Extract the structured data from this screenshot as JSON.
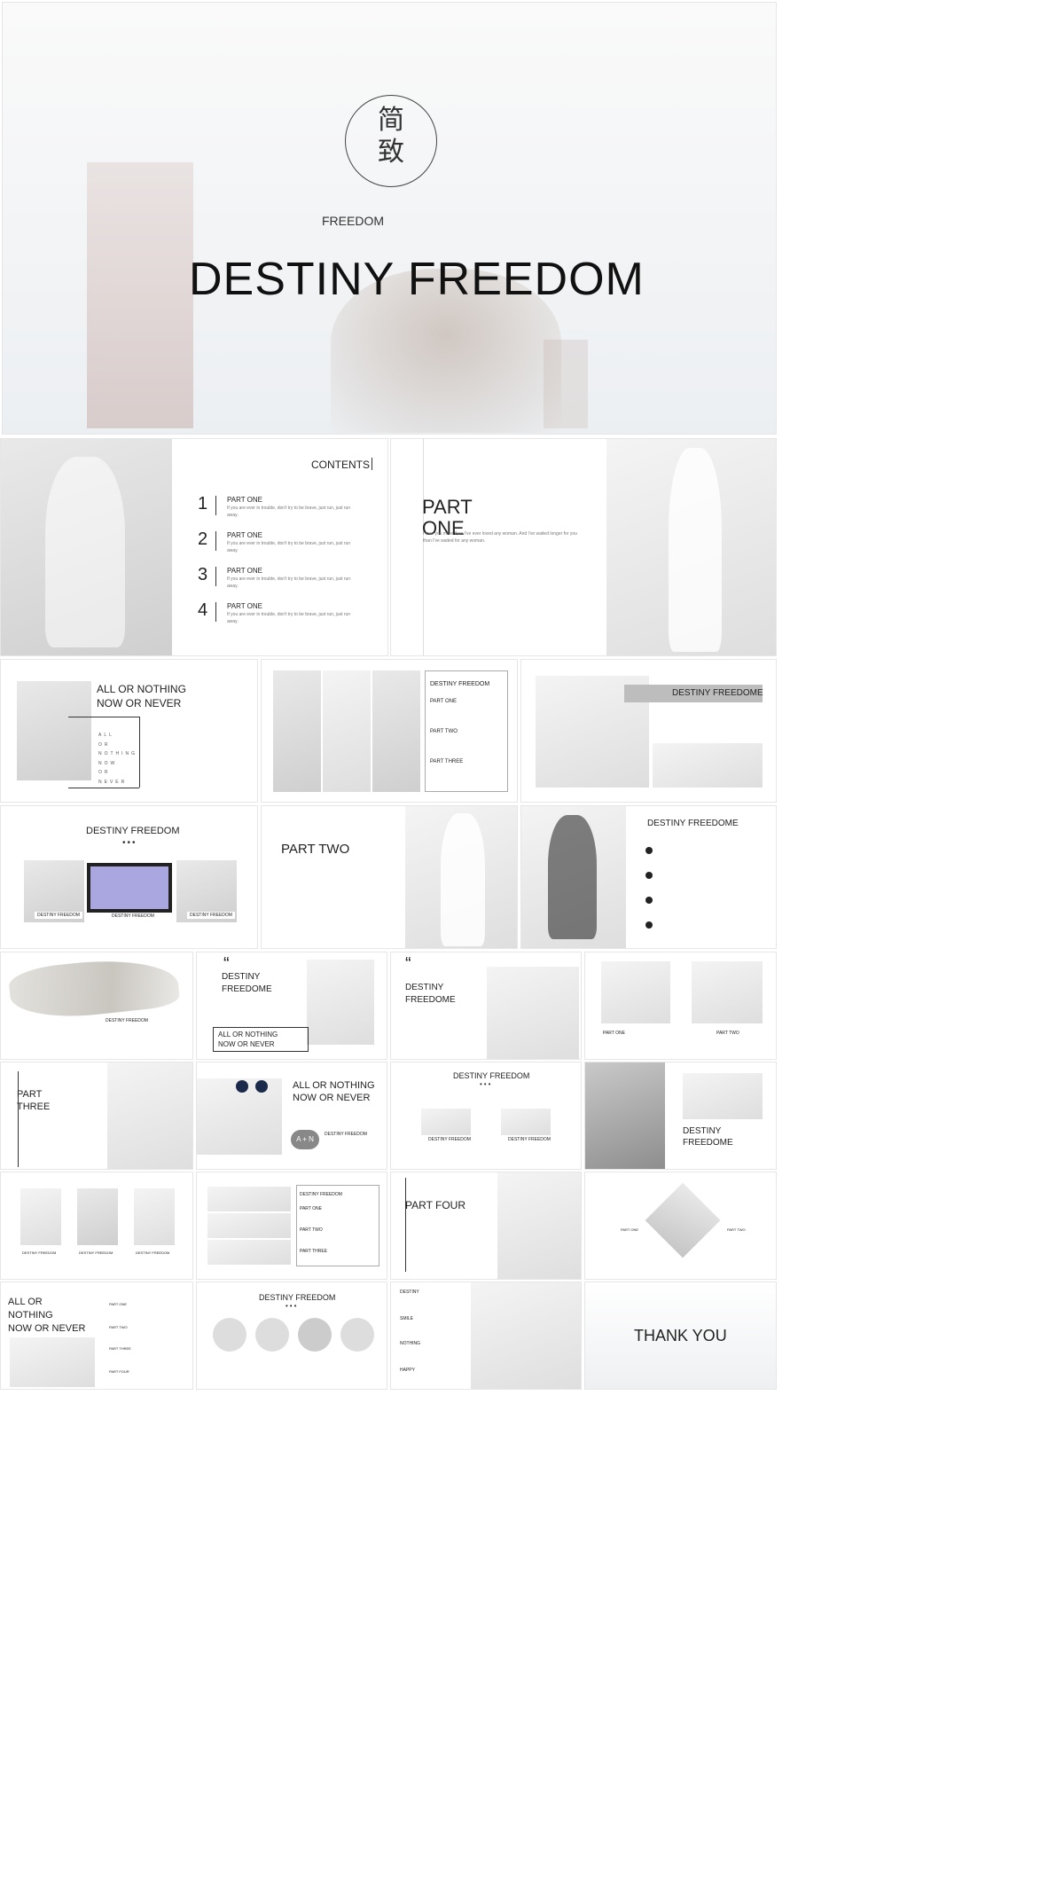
{
  "cover": {
    "emblem_line1": "简",
    "emblem_line2": "致",
    "kicker": "FREEDOM",
    "title": "DESTINY FREEDOM"
  },
  "contents": {
    "heading": "CONTENTS",
    "items": [
      {
        "num": "1",
        "label": "PART ONE",
        "desc": "If you are ever in trouble, don't try to be brave, just run, just run away."
      },
      {
        "num": "2",
        "label": "PART ONE",
        "desc": "If you are ever in trouble, don't try to be brave, just run, just run away."
      },
      {
        "num": "3",
        "label": "PART ONE",
        "desc": "If you are ever in trouble, don't try to be brave, just run, just run away."
      },
      {
        "num": "4",
        "label": "PART ONE",
        "desc": "If you are ever in trouble, don't try to be brave, just run, just run away."
      }
    ]
  },
  "part_one": {
    "title_line1": "PART",
    "title_line2": "ONE",
    "body": "I love you more than I've ever loved any woman. And I've waited longer for you than I've waited for any woman."
  },
  "slides": {
    "all_or_nothing": {
      "line1": "ALL OR NOTHING",
      "line2": "NOW OR NEVER",
      "vertical": [
        "ALL",
        "OR",
        "NOTHING",
        "NOW",
        "OR",
        "NEVER"
      ]
    },
    "collage": {
      "title": "DESTINY FREEDOM",
      "parts": [
        "PART ONE",
        "PART TWO",
        "PART THREE"
      ]
    },
    "destiny_freedome": {
      "title": "DESTINY FREEDOME"
    },
    "gallery3": {
      "title": "DESTINY FREEDOM",
      "dots": "•••",
      "captions": [
        "DESTINY FREEDOM",
        "DESTINY FREEDOM",
        "DESTINY FREEDOM"
      ]
    },
    "part_two": {
      "title": "PART TWO"
    },
    "list4": {
      "title": "DESTINY FREEDOME"
    },
    "brush": {
      "title": "DESTINY FREEDOM"
    },
    "quote1": {
      "mark": "“",
      "line1": "DESTINY",
      "line2": "FREEDOME",
      "box1": "ALL OR NOTHING",
      "box2": "NOW OR NEVER"
    },
    "quote2": {
      "mark": "“",
      "line1": "DESTINY",
      "line2": "FREEDOME"
    },
    "pair": {
      "cap1": "PART ONE",
      "cap2": "PART TWO"
    },
    "part_three": {
      "line1": "PART",
      "line2": "THREE"
    },
    "mickey": {
      "line1": "ALL OR NOTHING",
      "line2": "NOW OR NEVER",
      "circle": "A + N",
      "label": "DESTINY FREEDOM"
    },
    "two_products": {
      "title": "DESTINY FREEDOM",
      "dots": "•••",
      "cap1": "DESTINY FREEDOM",
      "cap2": "DESTINY FREEDOM"
    },
    "destiny_freedome2": {
      "line1": "DESTINY",
      "line2": "FREEDOME"
    },
    "three_people": {
      "caps": [
        "DESTINY FREEDOM",
        "DESTINY FREEDOM",
        "DESTINY FREEDOM"
      ]
    },
    "stacked": {
      "title": "DESTINY FREEDOM",
      "parts": [
        "PART ONE",
        "PART TWO",
        "PART THREE"
      ]
    },
    "part_four": {
      "title": "PART FOUR"
    },
    "diamond": {
      "cap1": "PART ONE",
      "cap2": "PART TWO"
    },
    "bike": {
      "line1": "ALL OR",
      "line2": "NOTHING",
      "line3": "NOW OR NEVER",
      "parts": [
        "PART ONE",
        "PART TWO",
        "PART THREE",
        "PART FOUR"
      ]
    },
    "circles4": {
      "title": "DESTINY FREEDOM",
      "dots": "•••"
    },
    "words": {
      "items": [
        "DESTINY",
        "SMILE",
        "NOTHING",
        "HAPPY"
      ]
    },
    "thanks": {
      "title": "THANK YOU"
    }
  }
}
